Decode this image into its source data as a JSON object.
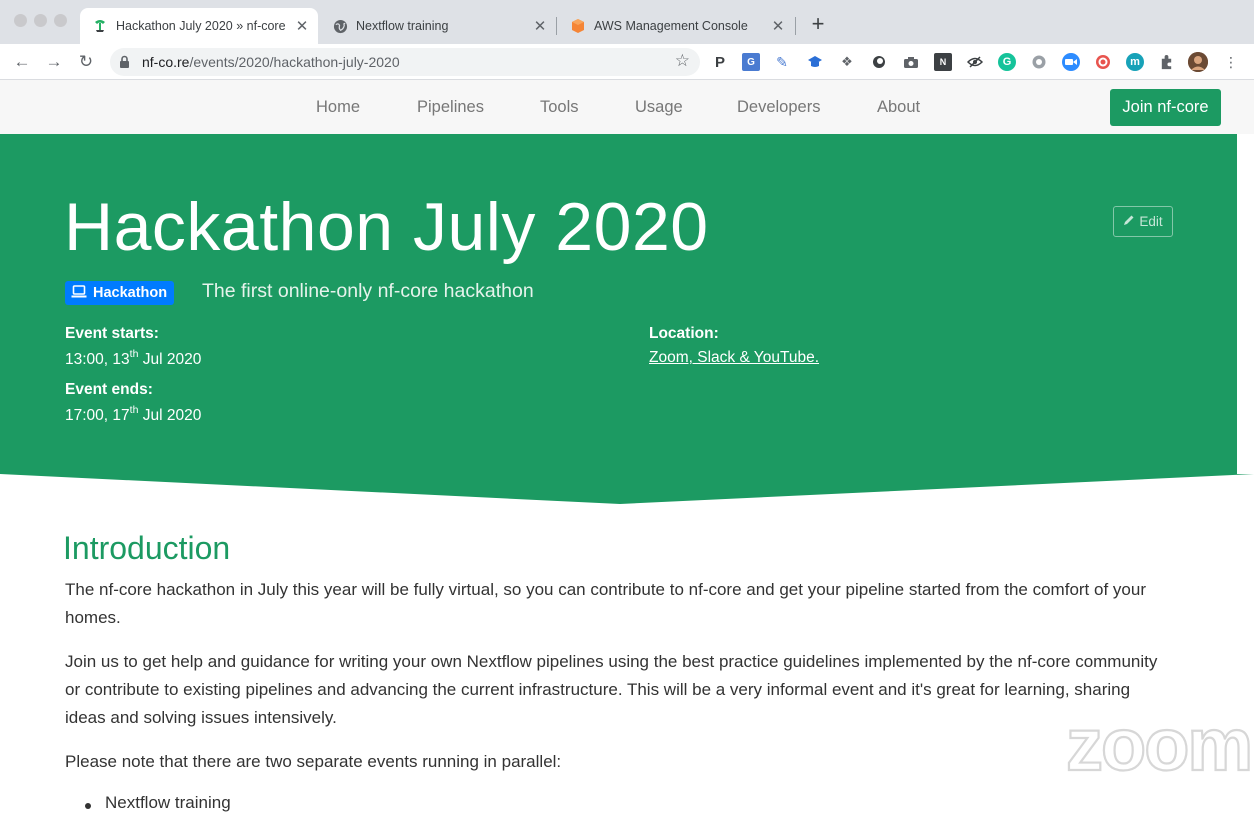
{
  "browser": {
    "tabs": [
      {
        "title": "Hackathon July 2020 » nf-core",
        "active": true
      },
      {
        "title": "Nextflow training",
        "active": false
      },
      {
        "title": "AWS Management Console",
        "active": false
      }
    ],
    "url_host": "nf-co.re",
    "url_path": "/events/2020/hackathon-july-2020",
    "extension_icons": [
      "puzzle-extension-icon",
      "translate-icon",
      "pen-icon",
      "graduation-cap-icon",
      "dropbox-icon",
      "circle-icon",
      "camera-icon",
      "notebook-icon",
      "eye-slash-icon",
      "grammarly-icon",
      "gear-icon",
      "zoom-icon",
      "target-icon",
      "m-icon",
      "extensions-icon",
      "profile-avatar"
    ]
  },
  "nav": {
    "links": [
      "Home",
      "Pipelines",
      "Tools",
      "Usage",
      "Developers",
      "About"
    ],
    "join_label": "Join nf-core"
  },
  "hero": {
    "title": "Hackathon July 2020",
    "edit_label": "Edit",
    "badge_label": "Hackathon",
    "subtitle": "The first online-only nf-core hackathon",
    "start_label": "Event starts:",
    "start_time": "13:00, 13",
    "start_sup": "th",
    "start_month": " Jul 2020",
    "end_label": "Event ends:",
    "end_time": "17:00, 17",
    "end_sup": "th",
    "end_month": " Jul 2020",
    "location_label": "Location:",
    "location_value": "Zoom, Slack & YouTube."
  },
  "content": {
    "heading": "Introduction",
    "para1": "The nf-core hackathon in July this year will be fully virtual, so you can contribute to nf-core and get your pipeline started from the comfort of your homes.",
    "para2": "Join us to get help and guidance for writing your own Nextflow pipelines using the best practice guidelines implemented by the nf-core community or contribute to existing pipelines and advancing the current infrastructure. This will be a very informal event and it's great for learning, sharing ideas and solving issues intensively.",
    "para3": "Please note that there are two separate events running in parallel:",
    "bullets": [
      "Nextflow training"
    ]
  },
  "watermark": "zoom",
  "colors": {
    "brand_green": "#1c9a62",
    "badge_blue": "#007bff"
  }
}
